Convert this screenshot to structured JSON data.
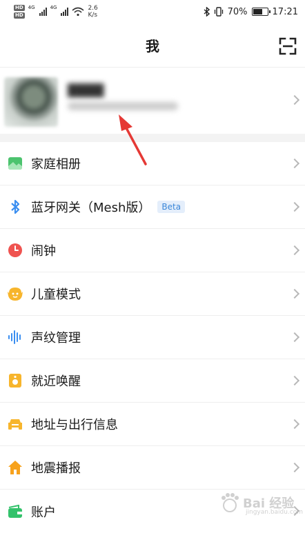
{
  "status_bar": {
    "hd1": "HD",
    "hd2": "HD",
    "sig_label1": "4G",
    "sig_label2": "4G",
    "speed_value": "2.6",
    "speed_unit": "K/s",
    "battery_text": "70%",
    "battery_level": 0.7,
    "time": "17:21"
  },
  "header": {
    "title": "我"
  },
  "menu": {
    "items": [
      {
        "label": "家庭相册",
        "icon": "photo-album-icon",
        "color": "#4cc36e"
      },
      {
        "label": "蓝牙网关（Mesh版）",
        "icon": "bluetooth-icon",
        "color": "#3a8ef0",
        "badge": "Beta"
      },
      {
        "label": "闹钟",
        "icon": "alarm-clock-icon",
        "color": "#ef5350"
      },
      {
        "label": "儿童模式",
        "icon": "kids-mode-icon",
        "color": "#f7b52c"
      },
      {
        "label": "声纹管理",
        "icon": "voiceprint-icon",
        "color": "#3a8ef0"
      },
      {
        "label": "就近唤醒",
        "icon": "speaker-icon",
        "color": "#f7b52c"
      },
      {
        "label": "地址与出行信息",
        "icon": "car-icon",
        "color": "#f7b52c"
      },
      {
        "label": "地震播报",
        "icon": "home-icon",
        "color": "#f7a21c"
      },
      {
        "label": "账户",
        "icon": "wallet-icon",
        "color": "#33c26b"
      }
    ]
  }
}
